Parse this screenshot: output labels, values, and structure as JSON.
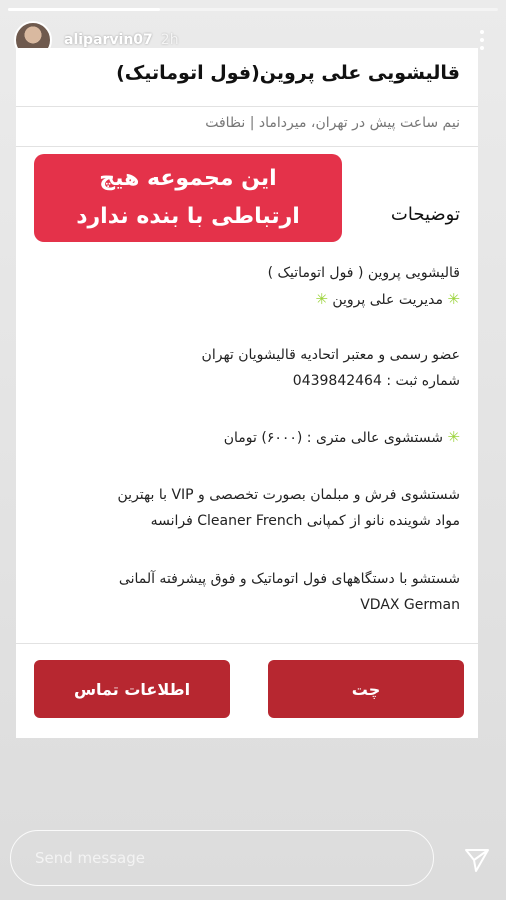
{
  "story": {
    "username": "aliparvin07",
    "time": "2h",
    "progress_fraction": 0.31
  },
  "card": {
    "title": "قالیشویی علی پروین(فول اتوماتیک)",
    "subtitle": "نیم ساعت پیش در تهران، میرداماد | نظافت",
    "section_title": "توضیحات",
    "notice_lines": [
      "این مجموعه هیچ",
      "ارتباطی با بنده ندارد"
    ],
    "desc_line_1": "قالیشویی پروین ( فول اتوماتیک )",
    "desc_line_2": "مدیریت علی پروین",
    "desc_line_3": "عضو رسمی و معتبر اتحادیه قالیشویان تهران",
    "desc_line_4": "شماره ثبت : 0439842464",
    "desc_line_5": "شستشوی عالی متری : (۶۰۰۰) تومان",
    "desc_line_6": "شستشوی فرش و مبلمان بصورت تخصصی و VIP با بهترین",
    "desc_line_7": "مواد شوینده نانو از کمپانی Cleaner French فرانسه",
    "desc_line_8": "شستشو با دستگاههای فول اتوماتیک و فوق پیشرفته آلمانی",
    "desc_line_9": "VDAX German",
    "chat_button": "چت",
    "contact_button": "اطلاعات تماس"
  },
  "composer": {
    "placeholder": "Send message"
  },
  "colors": {
    "notice": "#e4324a",
    "button": "#b72730",
    "icon_green": "#9bd33a"
  }
}
